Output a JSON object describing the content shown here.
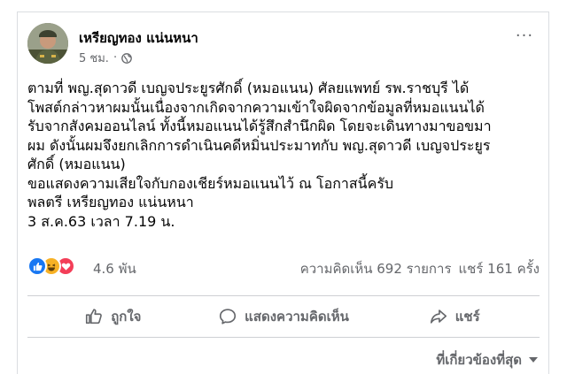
{
  "post": {
    "author": "เหรียญทอง แน่นหนา",
    "time": "5 ชม.",
    "privacy_icon": "globe-icon",
    "more_label": "···",
    "lines": [
      "ตามที่ พญ.สุดาวดี เบญจประยูรศักดิ์ (หมอแนน) ศัลยแพทย์ รพ.ราชบุรี ได้",
      "โพสต์กล่าวหาผมนั้นเนื่องจากเกิดจากความเข้าใจผิดจากข้อมูลที่หมอแนนได้",
      "รับจากสังคมออนไลน์ ทั้งนี้หมอแนนได้รู้สึกสำนึกผิด โดยจะเดินทางมาขอขมา",
      "ผม ดังนั้นผมจึงยกเลิกการดำเนินคดีหมิ่นประมาทกับ พญ.สุดาวดี เบญจประยูร",
      "ศักดิ์ (หมอแนน)",
      "ขอแสดงความเสียใจกับกองเชียร์หมอแนนไว้ ณ โอกาสนี้ครับ",
      "พลตรี เหรียญทอง แน่นหนา",
      "3 ส.ค.63 เวลา 7.19 น."
    ]
  },
  "reactions": {
    "count": "4.6 พัน",
    "comments": "ความคิดเห็น 692 รายการ",
    "shares": "แชร์ 161 ครั้ง"
  },
  "actions": {
    "like": "ถูกใจ",
    "comment": "แสดงความคิดเห็น",
    "share": "แชร์"
  },
  "sort": {
    "label": "ที่เกี่ยวข้องที่สุด"
  },
  "colors": {
    "text": "#050505",
    "secondary": "#65676b",
    "like_blue": "#1877f2",
    "haha_yellow": "#f7b125",
    "love_red": "#f33e58",
    "divider": "#ced0d4"
  }
}
